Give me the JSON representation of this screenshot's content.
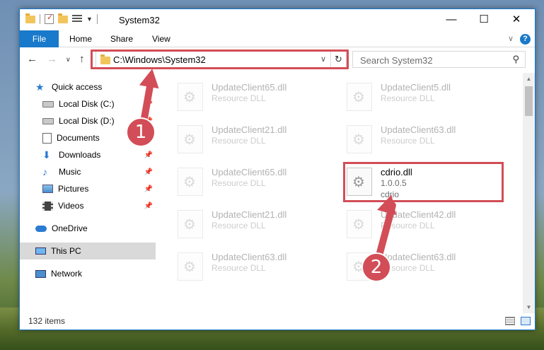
{
  "window": {
    "title": "System32",
    "controls": {
      "minimize": "—",
      "maximize": "☐",
      "close": "✕"
    }
  },
  "ribbon": {
    "tabs": [
      "File",
      "Home",
      "Share",
      "View"
    ],
    "help": "?"
  },
  "address": {
    "path": "C:\\Windows\\System32",
    "search_placeholder": "Search System32"
  },
  "nav": {
    "items": [
      {
        "label": "Quick access",
        "icon": "star-icon",
        "pinned": false
      },
      {
        "label": "Local Disk (C:)",
        "icon": "disk-icon",
        "pinned": true
      },
      {
        "label": "Local Disk (D:)",
        "icon": "disk-icon",
        "pinned": true
      },
      {
        "label": "Documents",
        "icon": "documents-icon",
        "pinned": true
      },
      {
        "label": "Downloads",
        "icon": "download-icon",
        "pinned": true
      },
      {
        "label": "Music",
        "icon": "music-icon",
        "pinned": true
      },
      {
        "label": "Pictures",
        "icon": "pictures-icon",
        "pinned": true
      },
      {
        "label": "Videos",
        "icon": "videos-icon",
        "pinned": true
      },
      {
        "label": "OneDrive",
        "icon": "cloud-icon",
        "pinned": false
      },
      {
        "label": "This PC",
        "icon": "pc-icon",
        "pinned": false,
        "selected": true
      },
      {
        "label": "Network",
        "icon": "network-icon",
        "pinned": false
      }
    ]
  },
  "files": [
    {
      "name": "UpdateClient65.dll",
      "line1": "Resource DLL",
      "line2": ""
    },
    {
      "name": "UpdateClient5.dll",
      "line1": "Resource DLL",
      "line2": ""
    },
    {
      "name": "UpdateClient21.dll",
      "line1": "Resource DLL",
      "line2": ""
    },
    {
      "name": "UpdateClient63.dll",
      "line1": "Resource DLL",
      "line2": ""
    },
    {
      "name": "UpdateClient65.dll",
      "line1": "Resource DLL",
      "line2": ""
    },
    {
      "name": "cdrio.dll",
      "line1": "1.0.0.5",
      "line2": "cdrio"
    },
    {
      "name": "UpdateClient21.dll",
      "line1": "Resource DLL",
      "line2": ""
    },
    {
      "name": "UpdateClient42.dll",
      "line1": "Resource DLL",
      "line2": ""
    },
    {
      "name": "UpdateClient63.dll",
      "line1": "Resource DLL",
      "line2": ""
    },
    {
      "name": "UpdateClient63.dll",
      "line1": "Resource DLL",
      "line2": ""
    }
  ],
  "status": {
    "count": "132 items"
  },
  "callouts": [
    "1",
    "2"
  ],
  "colors": {
    "accent": "#1979ca",
    "highlight": "#d24d57"
  }
}
